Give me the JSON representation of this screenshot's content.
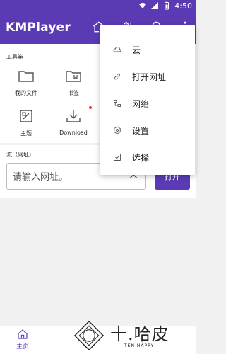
{
  "status_bar": {
    "time": "4:50",
    "icons": [
      "wifi-icon",
      "signal-icon",
      "battery-icon"
    ]
  },
  "app_bar": {
    "title": "KMPlayer",
    "actions": [
      "home-settings-icon",
      "sort-icon",
      "search-icon",
      "more-vert-icon"
    ],
    "background": "#5b3bb4"
  },
  "toolbox": {
    "heading": "工具箱",
    "items": [
      {
        "label": "我的文件",
        "icon": "folder-icon"
      },
      {
        "label": "书签",
        "icon": "bookmark-folder-icon"
      },
      {
        "label": "主题",
        "icon": "theme-icon"
      },
      {
        "label": "Download",
        "icon": "download-icon",
        "badge": true
      }
    ]
  },
  "stream": {
    "heading": "流（网址）",
    "placeholder": "请输入网址。",
    "open_label": "打开"
  },
  "menu": {
    "items": [
      {
        "label": "云",
        "icon": "cloud-icon"
      },
      {
        "label": "打开网址",
        "icon": "link-icon"
      },
      {
        "label": "网络",
        "icon": "network-icon"
      },
      {
        "label": "设置",
        "icon": "gear-icon"
      },
      {
        "label": "选择",
        "icon": "checkbox-icon"
      }
    ]
  },
  "bottom_nav": {
    "home_label": "主页"
  },
  "watermark": {
    "text": "十.哈皮",
    "sub": "TEN HAPPY"
  },
  "colors": {
    "accent": "#5b3bb4",
    "badge": "#e53935",
    "background": "#f1f1f1"
  }
}
